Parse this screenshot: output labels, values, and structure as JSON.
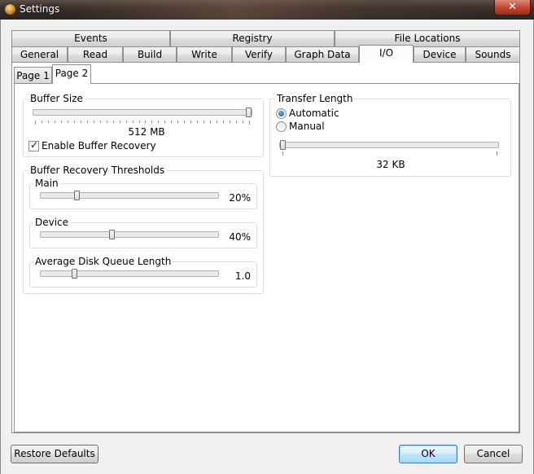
{
  "window": {
    "title": "Settings",
    "close_glyph": "✕"
  },
  "tabs_row1": [
    "Events",
    "Registry",
    "File Locations"
  ],
  "tabs_row2": [
    "General",
    "Read",
    "Build",
    "Write",
    "Verify",
    "Graph Data",
    "I/O",
    "Device",
    "Sounds"
  ],
  "active_tab": "I/O",
  "subtabs": [
    "Page 1",
    "Page 2"
  ],
  "active_subtab": "Page 2",
  "buffer_size": {
    "label": "Buffer Size",
    "value_text": "512 MB",
    "level": 1.0,
    "enable_recovery_label": "Enable Buffer Recovery",
    "enable_recovery_checked": true
  },
  "thresholds": {
    "label": "Buffer Recovery Thresholds",
    "main": {
      "label": "Main",
      "value_text": "20%",
      "level": 0.2
    },
    "device": {
      "label": "Device",
      "value_text": "40%",
      "level": 0.4
    },
    "queue": {
      "label": "Average Disk Queue Length",
      "value_text": "1.0",
      "level": 0.18
    }
  },
  "transfer_length": {
    "label": "Transfer Length",
    "automatic_label": "Automatic",
    "manual_label": "Manual",
    "selected": "Automatic",
    "value_text": "32 KB",
    "level": 0.0
  },
  "buttons": {
    "restore_defaults": "Restore Defaults",
    "ok": "OK",
    "cancel": "Cancel"
  }
}
